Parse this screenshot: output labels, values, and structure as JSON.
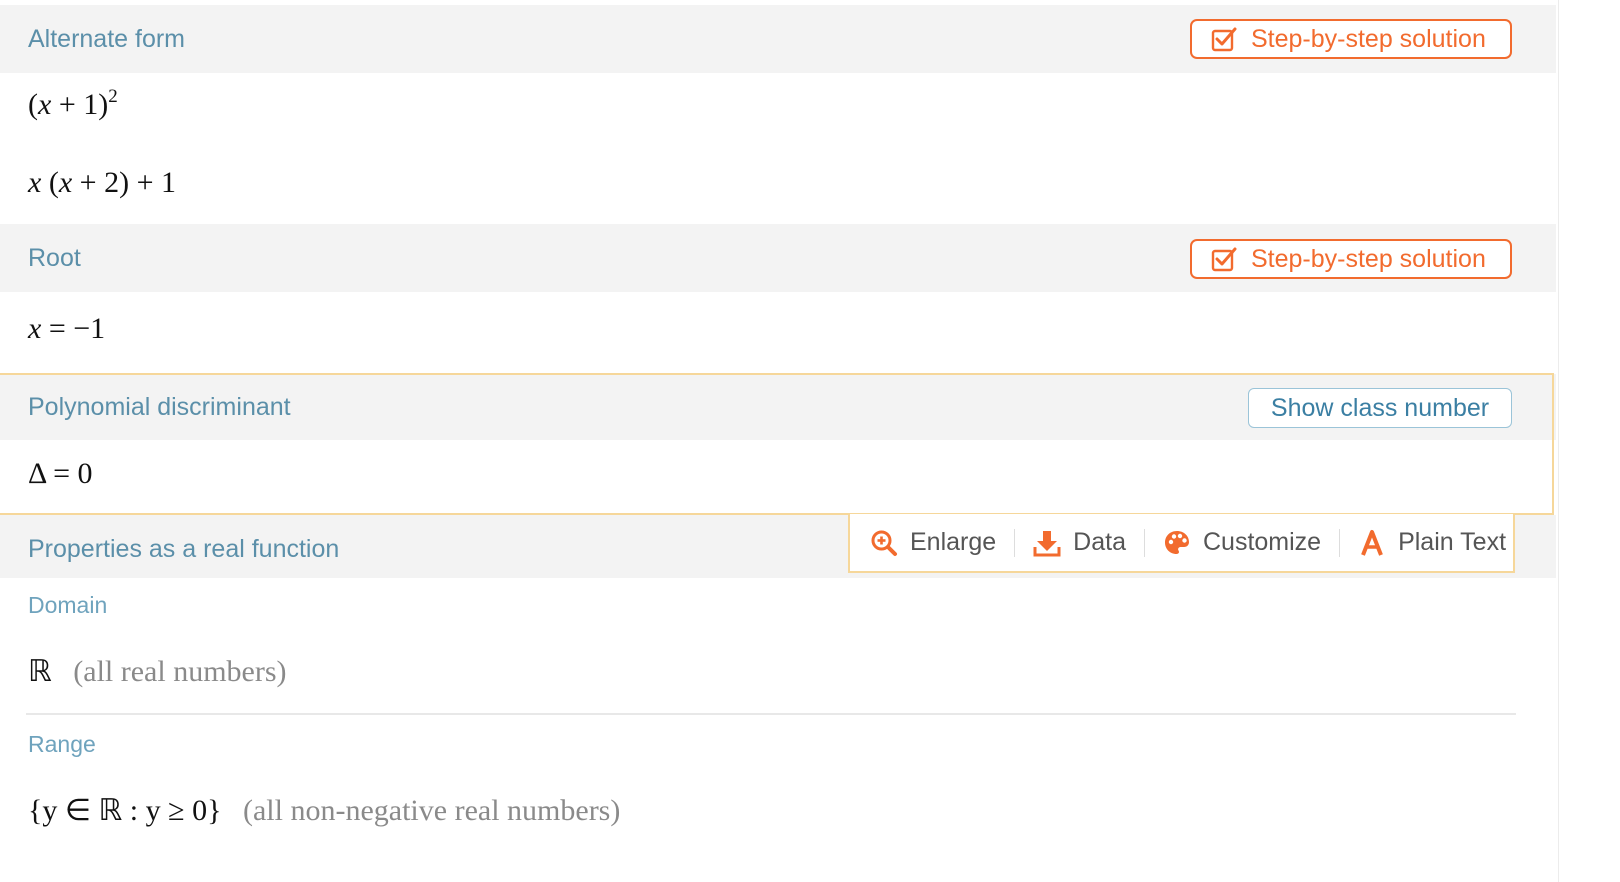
{
  "pods": {
    "alternate_form": {
      "title": "Alternate form",
      "button": "Step-by-step solution",
      "results": [
        "(x + 1)^2",
        "x (x + 2) + 1"
      ]
    },
    "root": {
      "title": "Root",
      "button": "Step-by-step solution",
      "result": "x = −1"
    },
    "discriminant": {
      "title": "Polynomial discriminant",
      "button": "Show class number",
      "result": "Δ = 0"
    },
    "properties": {
      "title": "Properties as a real function",
      "domain": {
        "label": "Domain",
        "value": "ℝ",
        "note": "(all real numbers)"
      },
      "range": {
        "label": "Range",
        "value": "{y ∈ ℝ : y ≥ 0}",
        "note": "(all non-negative real numbers)"
      }
    }
  },
  "toolbar": {
    "enlarge": "Enlarge",
    "data": "Data",
    "customize": "Customize",
    "plain_text": "Plain Text"
  },
  "colors": {
    "accent": "#f26b2e",
    "title_blue": "#5b8fa9",
    "highlight_border": "#f6d79a",
    "header_bg": "#f3f3f3"
  },
  "icons": {
    "step_button": "checked-box-icon",
    "enlarge": "zoom-in-icon",
    "data": "download-icon",
    "customize": "palette-icon",
    "plain_text": "letter-a-icon"
  }
}
